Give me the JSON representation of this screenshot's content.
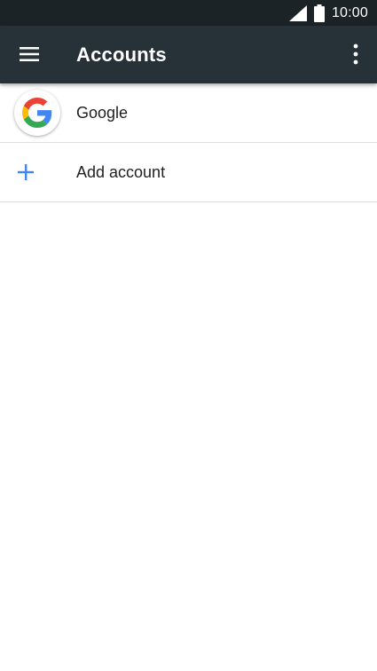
{
  "status_bar": {
    "time": "10:00",
    "icons": [
      "signal-icon",
      "battery-icon"
    ]
  },
  "app_bar": {
    "title": "Accounts",
    "background": "#263238",
    "icons": [
      "hamburger-menu-icon",
      "more-vert-icon"
    ]
  },
  "accounts": [
    {
      "label": "Google",
      "icon": "google-logo-icon"
    },
    {
      "label": "Add account",
      "icon": "plus-icon",
      "icon_color": "#4285f4"
    }
  ]
}
